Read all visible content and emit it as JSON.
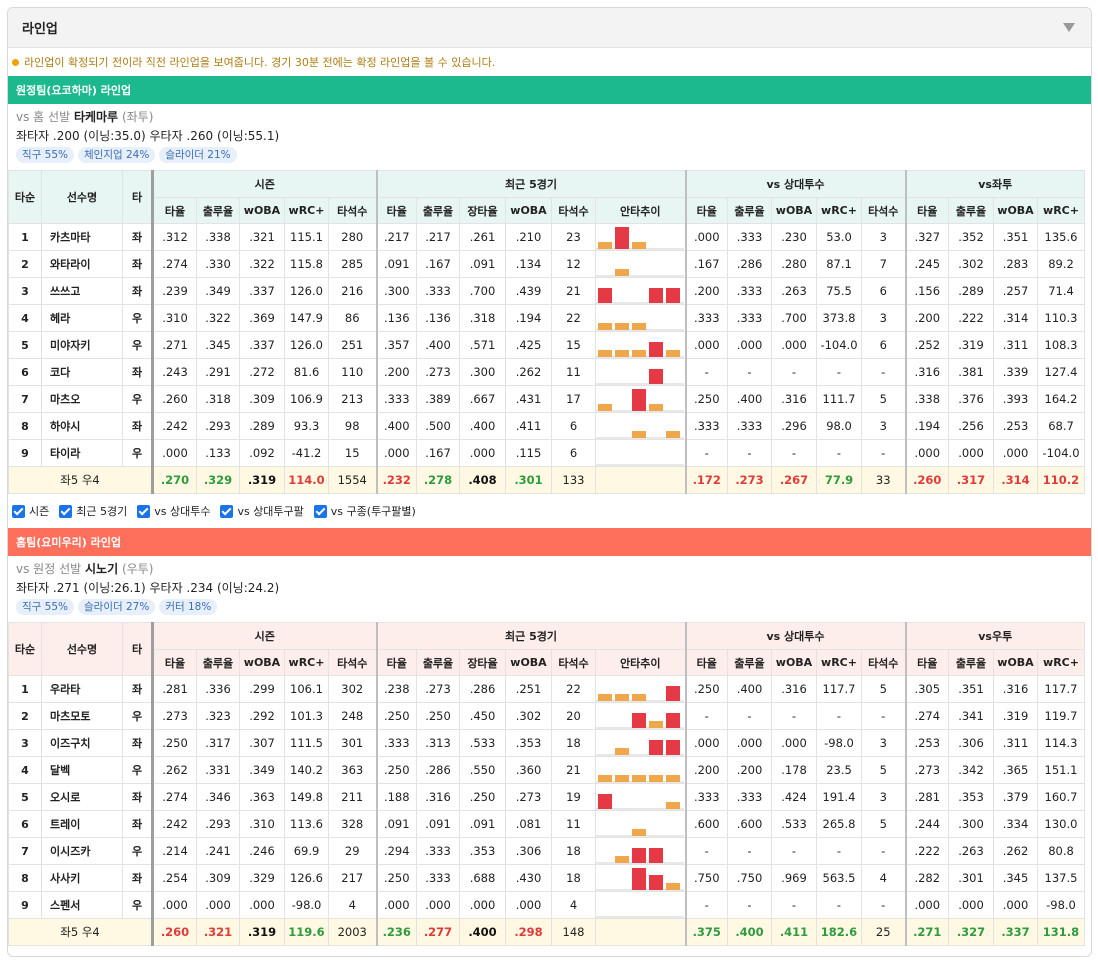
{
  "panel_title": "라인업",
  "notice": "라인업이 확정되기 전이라 직전 라인업을 보여줍니다. 경기 30분 전에는 확정 라인업을 볼 수 있습니다.",
  "colors": {
    "away_bar": "#1bb98d",
    "home_bar": "#ff705c",
    "away_head_bg": "#e8f6f3",
    "home_head_bg": "#fdeeec",
    "bar_low": "#f0a64a",
    "bar_high": "#e63946"
  },
  "away": {
    "bar": "원정팀(요코하마) 라인업",
    "vs_prefix": "vs 홈 선발",
    "pitcher": "타케마루",
    "throws": "(좌투)",
    "split_line": "좌타자 .200 (이닝:35.0)  우타자 .260 (이닝:55.1)",
    "tags": [
      "직구 55%",
      "체인지업 24%",
      "슬라이더 21%"
    ],
    "split_group": "vs좌투"
  },
  "home": {
    "bar": "홈팀(요미우리) 라인업",
    "vs_prefix": "vs 원정 선발",
    "pitcher": "시노기",
    "throws": "(우투)",
    "split_line": "좌타자 .271 (이닝:26.1)  우타자 .234 (이닝:24.2)",
    "tags": [
      "직구 55%",
      "슬라이더 27%",
      "커터 18%"
    ],
    "split_group": "vs우투"
  },
  "headers": {
    "order": "타순",
    "name": "선수명",
    "hand": "타",
    "season": "시즌",
    "recent": "최근 5경기",
    "vs_pitcher": "vs 상대투수",
    "season_cols": [
      "타율",
      "출루율",
      "wOBA",
      "wRC+",
      "타석수"
    ],
    "recent_cols": [
      "타율",
      "출루율",
      "장타율",
      "wOBA",
      "타석수",
      "안타추이"
    ],
    "vsp_cols": [
      "타율",
      "출루율",
      "wOBA",
      "wRC+",
      "타석수"
    ],
    "split_cols": [
      "타율",
      "출루율",
      "wOBA",
      "wRC+"
    ]
  },
  "checks": [
    "시즌",
    "최근 5경기",
    "vs 상대투수",
    "vs 상대투구팔",
    "vs 구종(투구팔별)"
  ],
  "away_rows": [
    {
      "o": "1",
      "n": "카츠마타",
      "h": "좌",
      "s": [
        ".312",
        ".338",
        ".321",
        "115.1",
        "280"
      ],
      "r": [
        ".217",
        ".217",
        ".261",
        ".210",
        "23"
      ],
      "t": [
        1,
        3,
        1,
        0,
        0
      ],
      "v": [
        ".000",
        ".333",
        ".230",
        "53.0",
        "3"
      ],
      "x": [
        ".327",
        ".352",
        ".351",
        "135.6"
      ]
    },
    {
      "o": "2",
      "n": "와타라이",
      "h": "좌",
      "s": [
        ".274",
        ".330",
        ".322",
        "115.8",
        "285"
      ],
      "r": [
        ".091",
        ".167",
        ".091",
        ".134",
        "12"
      ],
      "t": [
        0,
        1,
        0,
        0,
        0
      ],
      "v": [
        ".167",
        ".286",
        ".280",
        "87.1",
        "7"
      ],
      "x": [
        ".245",
        ".302",
        ".283",
        "89.2"
      ]
    },
    {
      "o": "3",
      "n": "쓰쓰고",
      "h": "좌",
      "s": [
        ".239",
        ".349",
        ".337",
        "126.0",
        "216"
      ],
      "r": [
        ".300",
        ".333",
        ".700",
        ".439",
        "21"
      ],
      "t": [
        2,
        0,
        0,
        2,
        2
      ],
      "v": [
        ".200",
        ".333",
        ".263",
        "75.5",
        "6"
      ],
      "x": [
        ".156",
        ".289",
        ".257",
        "71.4"
      ]
    },
    {
      "o": "4",
      "n": "헤라",
      "h": "우",
      "s": [
        ".310",
        ".322",
        ".369",
        "147.9",
        "86"
      ],
      "r": [
        ".136",
        ".136",
        ".318",
        ".194",
        "22"
      ],
      "t": [
        1,
        1,
        1,
        0,
        0
      ],
      "v": [
        ".333",
        ".333",
        ".700",
        "373.8",
        "3"
      ],
      "x": [
        ".200",
        ".222",
        ".314",
        "110.3"
      ]
    },
    {
      "o": "5",
      "n": "미야자키",
      "h": "우",
      "s": [
        ".271",
        ".345",
        ".337",
        "126.0",
        "251"
      ],
      "r": [
        ".357",
        ".400",
        ".571",
        ".425",
        "15"
      ],
      "t": [
        1,
        1,
        1,
        2,
        1
      ],
      "v": [
        ".000",
        ".000",
        ".000",
        "-104.0",
        "6"
      ],
      "x": [
        ".252",
        ".319",
        ".311",
        "108.3"
      ]
    },
    {
      "o": "6",
      "n": "코다",
      "h": "좌",
      "s": [
        ".243",
        ".291",
        ".272",
        "81.6",
        "110"
      ],
      "r": [
        ".200",
        ".273",
        ".300",
        ".262",
        "11"
      ],
      "t": [
        0,
        0,
        0,
        2,
        0
      ],
      "v": [
        "-",
        "-",
        "-",
        "-",
        "-"
      ],
      "x": [
        ".316",
        ".381",
        ".339",
        "127.4"
      ]
    },
    {
      "o": "7",
      "n": "마츠오",
      "h": "우",
      "s": [
        ".260",
        ".318",
        ".309",
        "106.9",
        "213"
      ],
      "r": [
        ".333",
        ".389",
        ".667",
        ".431",
        "17"
      ],
      "t": [
        1,
        0,
        3,
        1,
        0
      ],
      "v": [
        ".250",
        ".400",
        ".316",
        "111.7",
        "5"
      ],
      "x": [
        ".338",
        ".376",
        ".393",
        "164.2"
      ]
    },
    {
      "o": "8",
      "n": "하야시",
      "h": "좌",
      "s": [
        ".242",
        ".293",
        ".289",
        "93.3",
        "98"
      ],
      "r": [
        ".400",
        ".500",
        ".400",
        ".411",
        "6"
      ],
      "t": [
        0,
        0,
        1,
        0,
        1
      ],
      "v": [
        ".333",
        ".333",
        ".296",
        "98.0",
        "3"
      ],
      "x": [
        ".194",
        ".256",
        ".253",
        "68.7"
      ]
    },
    {
      "o": "9",
      "n": "타이라",
      "h": "우",
      "s": [
        ".000",
        ".133",
        ".092",
        "-41.2",
        "15"
      ],
      "r": [
        ".000",
        ".167",
        ".000",
        ".115",
        "6"
      ],
      "t": [
        0,
        0,
        0,
        0,
        0
      ],
      "v": [
        "-",
        "-",
        "-",
        "-",
        "-"
      ],
      "x": [
        ".000",
        ".000",
        ".000",
        "-104.0"
      ]
    }
  ],
  "away_total": {
    "label": "좌5 우4",
    "s": [
      ".270",
      ".329",
      ".319",
      "114.0",
      "1554"
    ],
    "sc": [
      "pos",
      "pos",
      "neu",
      "neg",
      "cnt"
    ],
    "r": [
      ".232",
      ".278",
      ".408",
      ".301",
      "133"
    ],
    "rc": [
      "neg",
      "pos",
      "neu",
      "pos",
      "cnt"
    ],
    "v": [
      ".172",
      ".273",
      ".267",
      "77.9",
      "33"
    ],
    "vc": [
      "neg",
      "neg",
      "neg",
      "pos",
      "cnt"
    ],
    "x": [
      ".260",
      ".317",
      ".314",
      "110.2"
    ],
    "xc": [
      "neg",
      "neg",
      "neg",
      "neg"
    ]
  },
  "home_rows": [
    {
      "o": "1",
      "n": "우라타",
      "h": "좌",
      "s": [
        ".281",
        ".336",
        ".299",
        "106.1",
        "302"
      ],
      "r": [
        ".238",
        ".273",
        ".286",
        ".251",
        "22"
      ],
      "t": [
        1,
        1,
        1,
        0,
        2
      ],
      "v": [
        ".250",
        ".400",
        ".316",
        "117.7",
        "5"
      ],
      "x": [
        ".305",
        ".351",
        ".316",
        "117.7"
      ]
    },
    {
      "o": "2",
      "n": "마츠모토",
      "h": "우",
      "s": [
        ".273",
        ".323",
        ".292",
        "101.3",
        "248"
      ],
      "r": [
        ".250",
        ".250",
        ".450",
        ".302",
        "20"
      ],
      "t": [
        0,
        0,
        2,
        1,
        2
      ],
      "v": [
        "-",
        "-",
        "-",
        "-",
        "-"
      ],
      "x": [
        ".274",
        ".341",
        ".319",
        "119.7"
      ]
    },
    {
      "o": "3",
      "n": "이즈구치",
      "h": "좌",
      "s": [
        ".250",
        ".317",
        ".307",
        "111.5",
        "301"
      ],
      "r": [
        ".333",
        ".313",
        ".533",
        ".353",
        "18"
      ],
      "t": [
        0,
        1,
        0,
        2,
        2
      ],
      "v": [
        ".000",
        ".000",
        ".000",
        "-98.0",
        "3"
      ],
      "x": [
        ".253",
        ".306",
        ".311",
        "114.3"
      ]
    },
    {
      "o": "4",
      "n": "달벡",
      "h": "우",
      "s": [
        ".262",
        ".331",
        ".349",
        "140.2",
        "363"
      ],
      "r": [
        ".250",
        ".286",
        ".550",
        ".360",
        "21"
      ],
      "t": [
        1,
        1,
        1,
        1,
        1
      ],
      "v": [
        ".200",
        ".200",
        ".178",
        "23.5",
        "5"
      ],
      "x": [
        ".273",
        ".342",
        ".365",
        "151.1"
      ]
    },
    {
      "o": "5",
      "n": "오시로",
      "h": "좌",
      "s": [
        ".274",
        ".346",
        ".363",
        "149.8",
        "211"
      ],
      "r": [
        ".188",
        ".316",
        ".250",
        ".273",
        "19"
      ],
      "t": [
        2,
        0,
        0,
        0,
        1
      ],
      "v": [
        ".333",
        ".333",
        ".424",
        "191.4",
        "3"
      ],
      "x": [
        ".281",
        ".353",
        ".379",
        "160.7"
      ]
    },
    {
      "o": "6",
      "n": "트레이",
      "h": "좌",
      "s": [
        ".242",
        ".293",
        ".310",
        "113.6",
        "328"
      ],
      "r": [
        ".091",
        ".091",
        ".091",
        ".081",
        "11"
      ],
      "t": [
        0,
        0,
        1,
        0,
        0
      ],
      "v": [
        ".600",
        ".600",
        ".533",
        "265.8",
        "5"
      ],
      "x": [
        ".244",
        ".300",
        ".334",
        "130.0"
      ]
    },
    {
      "o": "7",
      "n": "이시즈카",
      "h": "우",
      "s": [
        ".214",
        ".241",
        ".246",
        "69.9",
        "29"
      ],
      "r": [
        ".294",
        ".333",
        ".353",
        ".306",
        "18"
      ],
      "t": [
        0,
        1,
        2,
        2,
        0
      ],
      "v": [
        "-",
        "-",
        "-",
        "-",
        "-"
      ],
      "x": [
        ".222",
        ".263",
        ".262",
        "80.8"
      ]
    },
    {
      "o": "8",
      "n": "사사키",
      "h": "좌",
      "s": [
        ".254",
        ".309",
        ".329",
        "126.6",
        "217"
      ],
      "r": [
        ".250",
        ".333",
        ".688",
        ".430",
        "18"
      ],
      "t": [
        0,
        0,
        3,
        2,
        1
      ],
      "v": [
        ".750",
        ".750",
        ".969",
        "563.5",
        "4"
      ],
      "x": [
        ".282",
        ".301",
        ".345",
        "137.5"
      ]
    },
    {
      "o": "9",
      "n": "스펜서",
      "h": "우",
      "s": [
        ".000",
        ".000",
        ".000",
        "-98.0",
        "4"
      ],
      "r": [
        ".000",
        ".000",
        ".000",
        ".000",
        "4"
      ],
      "t": [
        0,
        0,
        0,
        0,
        0
      ],
      "v": [
        "-",
        "-",
        "-",
        "-",
        "-"
      ],
      "x": [
        ".000",
        ".000",
        ".000",
        "-98.0"
      ]
    }
  ],
  "home_total": {
    "label": "좌5 우4",
    "s": [
      ".260",
      ".321",
      ".319",
      "119.6",
      "2003"
    ],
    "sc": [
      "neg",
      "neg",
      "neu",
      "pos",
      "cnt"
    ],
    "r": [
      ".236",
      ".277",
      ".400",
      ".298",
      "148"
    ],
    "rc": [
      "pos",
      "neg",
      "neu",
      "neg",
      "cnt"
    ],
    "v": [
      ".375",
      ".400",
      ".411",
      "182.6",
      "25"
    ],
    "vc": [
      "pos",
      "pos",
      "pos",
      "pos",
      "cnt"
    ],
    "x": [
      ".271",
      ".327",
      ".337",
      "131.8"
    ],
    "xc": [
      "pos",
      "pos",
      "pos",
      "pos"
    ]
  }
}
